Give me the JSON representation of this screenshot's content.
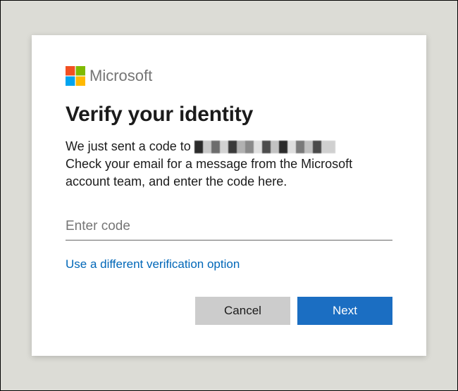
{
  "brand": {
    "name": "Microsoft",
    "colors": {
      "topLeft": "#f25022",
      "topRight": "#7fba00",
      "bottomLeft": "#00a4ef",
      "bottomRight": "#ffb900"
    }
  },
  "heading": "Verify your identity",
  "description": {
    "prefix": "We just sent a code to ",
    "rest": "Check your email for a message from the Microsoft account team, and enter the code here."
  },
  "input": {
    "placeholder": "Enter code",
    "value": ""
  },
  "altLink": "Use a different verification option",
  "buttons": {
    "cancel": "Cancel",
    "next": "Next"
  }
}
